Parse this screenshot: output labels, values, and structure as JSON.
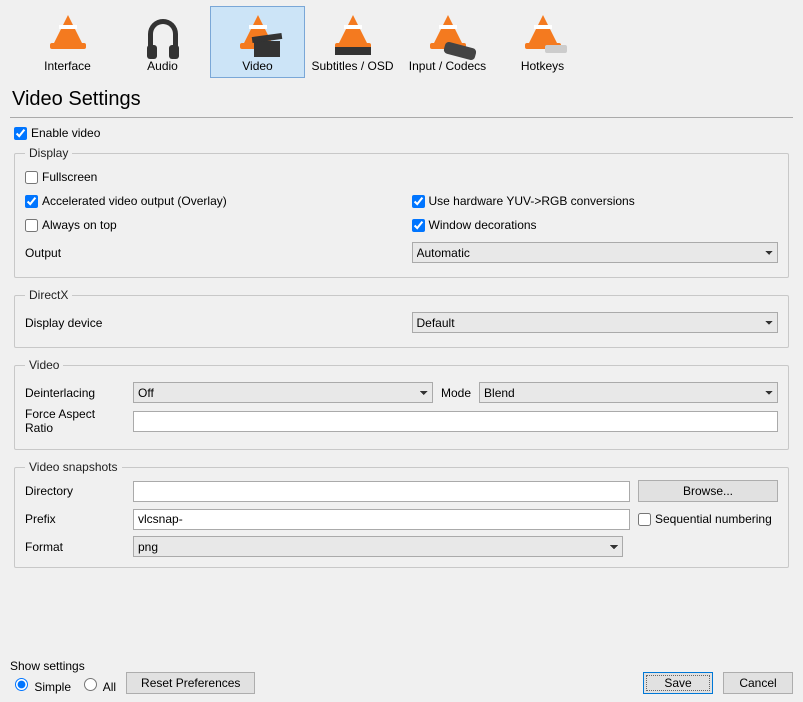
{
  "toolbar": {
    "items": [
      {
        "label": "Interface"
      },
      {
        "label": "Audio"
      },
      {
        "label": "Video"
      },
      {
        "label": "Subtitles / OSD"
      },
      {
        "label": "Input / Codecs"
      },
      {
        "label": "Hotkeys"
      }
    ],
    "selected_index": 2
  },
  "page_title": "Video Settings",
  "enable_video": {
    "label": "Enable video",
    "checked": true
  },
  "display": {
    "legend": "Display",
    "fullscreen": {
      "label": "Fullscreen",
      "checked": false
    },
    "accelerated": {
      "label": "Accelerated video output (Overlay)",
      "checked": true
    },
    "always_on_top": {
      "label": "Always on top",
      "checked": false
    },
    "hw_yuv": {
      "label": "Use hardware YUV->RGB conversions",
      "checked": true
    },
    "window_dec": {
      "label": "Window decorations",
      "checked": true
    },
    "output_label": "Output",
    "output_value": "Automatic"
  },
  "directx": {
    "legend": "DirectX",
    "display_device_label": "Display device",
    "display_device_value": "Default"
  },
  "video": {
    "legend": "Video",
    "deint_label": "Deinterlacing",
    "deint_value": "Off",
    "mode_label": "Mode",
    "mode_value": "Blend",
    "far_label": "Force Aspect Ratio",
    "far_value": ""
  },
  "snapshots": {
    "legend": "Video snapshots",
    "directory_label": "Directory",
    "directory_value": "",
    "browse_label": "Browse...",
    "prefix_label": "Prefix",
    "prefix_value": "vlcsnap-",
    "seq_label": "Sequential numbering",
    "seq_checked": false,
    "format_label": "Format",
    "format_value": "png"
  },
  "footer": {
    "show_settings_label": "Show settings",
    "simple_label": "Simple",
    "all_label": "All",
    "selected": "simple",
    "reset_label": "Reset Preferences",
    "save_label": "Save",
    "cancel_label": "Cancel"
  }
}
